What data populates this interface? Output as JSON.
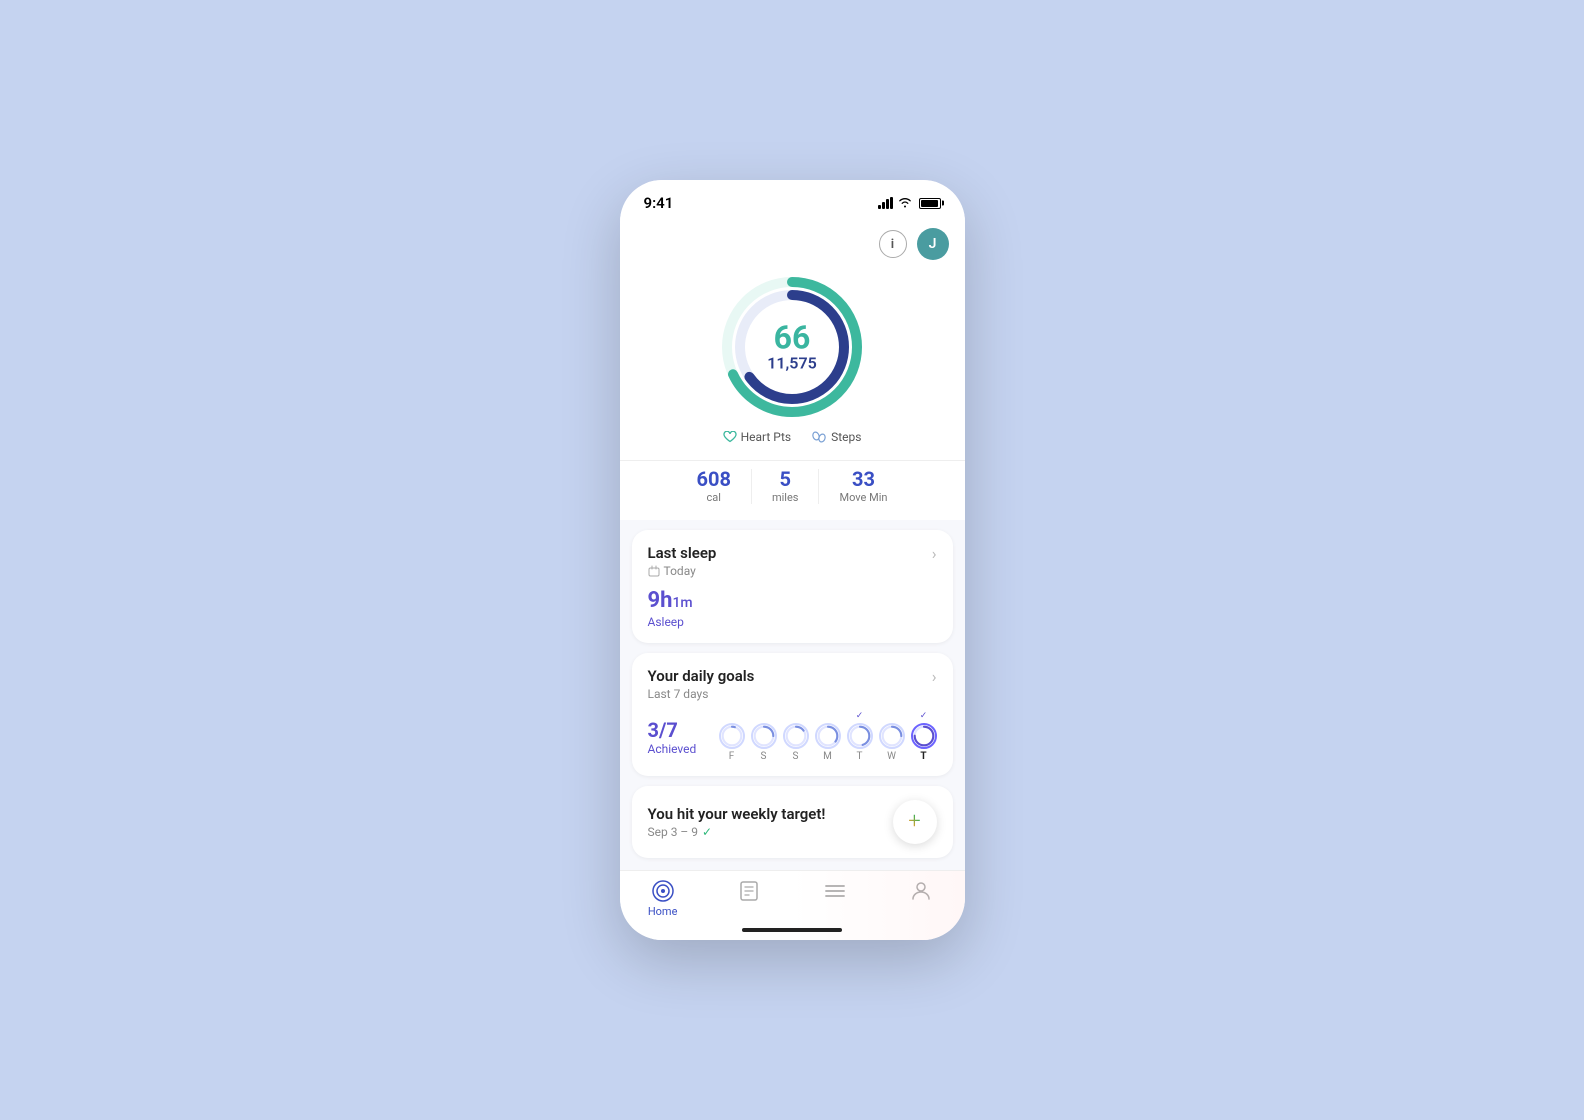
{
  "statusBar": {
    "time": "9:41"
  },
  "header": {
    "infoLabel": "i",
    "avatarLabel": "J"
  },
  "ring": {
    "heartPts": "66",
    "steps": "11,575",
    "heartPtsLabel": "Heart Pts",
    "stepsLabel": "Steps"
  },
  "stats": [
    {
      "value": "608",
      "label": "cal"
    },
    {
      "value": "5",
      "label": "miles"
    },
    {
      "value": "33",
      "label": "Move Min"
    }
  ],
  "sleepCard": {
    "title": "Last sleep",
    "subtitle": "Today",
    "sleepHours": "9h",
    "sleepMins": "1m",
    "sleepLabel": "Asleep"
  },
  "goalsCard": {
    "title": "Your daily goals",
    "subtitle": "Last 7 days",
    "fraction": "3/7",
    "fractionLabel": "Achieved",
    "days": [
      {
        "label": "F",
        "checked": false,
        "arcFill": 0.3
      },
      {
        "label": "S",
        "checked": false,
        "arcFill": 0.5
      },
      {
        "label": "S",
        "checked": false,
        "arcFill": 0.4
      },
      {
        "label": "M",
        "checked": false,
        "arcFill": 0.6
      },
      {
        "label": "T",
        "checked": true,
        "arcFill": 0.7
      },
      {
        "label": "W",
        "checked": false,
        "arcFill": 0.5
      },
      {
        "label": "T",
        "checked": true,
        "arcFill": 1.0,
        "today": true
      }
    ]
  },
  "weeklyCard": {
    "title": "You hit your weekly target!",
    "subtitle": "Sep 3 – 9"
  },
  "bottomNav": {
    "items": [
      {
        "label": "Home",
        "icon": "⌂",
        "active": true
      },
      {
        "label": "",
        "icon": "📋",
        "active": false
      },
      {
        "label": "",
        "icon": "☰",
        "active": false
      },
      {
        "label": "",
        "icon": "👤",
        "active": false
      }
    ]
  }
}
